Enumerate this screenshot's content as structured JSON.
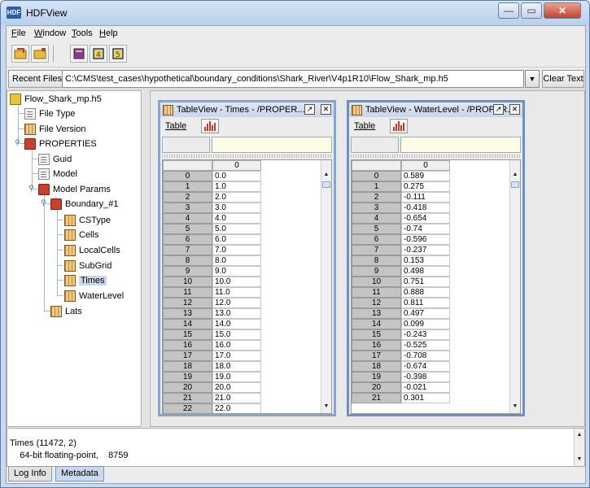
{
  "app": {
    "title": "HDFView",
    "icon_text": "HDF",
    "accent": "#2c5fa8"
  },
  "window_controls": {
    "minimize": "—",
    "maximize": "▭",
    "close": "✕"
  },
  "menu": [
    {
      "label": "File",
      "mnemonic": "F",
      "rest": "ile"
    },
    {
      "label": "Window",
      "mnemonic": "W",
      "rest": "indow"
    },
    {
      "label": "Tools",
      "mnemonic": "T",
      "rest": "ools"
    },
    {
      "label": "Help",
      "mnemonic": "H",
      "rest": "elp"
    }
  ],
  "toolbar": {
    "icons": [
      "open-file-icon",
      "open-folder-icon",
      "book-icon",
      "users-guide-icon",
      "hdf5-guide-icon"
    ]
  },
  "recent": {
    "button_label": "Recent Files",
    "path": "C:\\CMS\\test_cases\\hypothetical\\boundary_conditions\\Shark_River\\V4p1R10\\Flow_Shark_mp.h5",
    "clear_label": "Clear Text"
  },
  "tree": {
    "nodes": [
      {
        "label": "Flow_Shark_mp.h5",
        "icon": "hdf-file-icon"
      },
      {
        "label": "File Type",
        "icon": "attribute-icon"
      },
      {
        "label": "File Version",
        "icon": "dataset-icon"
      },
      {
        "label": "PROPERTIES",
        "icon": "group-folder-icon"
      },
      {
        "label": "Guid",
        "icon": "attribute-icon"
      },
      {
        "label": "Model",
        "icon": "attribute-icon"
      },
      {
        "label": "Model Params",
        "icon": "group-folder-icon"
      },
      {
        "label": "Boundary_#1",
        "icon": "group-folder-icon"
      },
      {
        "label": "CSType",
        "icon": "dataset-icon"
      },
      {
        "label": "Cells",
        "icon": "dataset-icon"
      },
      {
        "label": "LocalCells",
        "icon": "dataset-icon"
      },
      {
        "label": "SubGrid",
        "icon": "dataset-icon"
      },
      {
        "label": "Times",
        "icon": "dataset-icon",
        "selected": true
      },
      {
        "label": "WaterLevel",
        "icon": "dataset-icon"
      },
      {
        "label": "Lats",
        "icon": "dataset-icon"
      }
    ]
  },
  "tables": [
    {
      "title": "TableView  -  Times  -  /PROPER...",
      "menu_label": "Table",
      "column_header": "0",
      "rows": [
        {
          "index": "0",
          "value": "0.0"
        },
        {
          "index": "1",
          "value": "1.0"
        },
        {
          "index": "2",
          "value": "2.0"
        },
        {
          "index": "3",
          "value": "3.0"
        },
        {
          "index": "4",
          "value": "4.0"
        },
        {
          "index": "5",
          "value": "5.0"
        },
        {
          "index": "6",
          "value": "6.0"
        },
        {
          "index": "7",
          "value": "7.0"
        },
        {
          "index": "8",
          "value": "8.0"
        },
        {
          "index": "9",
          "value": "9.0"
        },
        {
          "index": "10",
          "value": "10.0"
        },
        {
          "index": "11",
          "value": "11.0"
        },
        {
          "index": "12",
          "value": "12.0"
        },
        {
          "index": "13",
          "value": "13.0"
        },
        {
          "index": "14",
          "value": "14.0"
        },
        {
          "index": "15",
          "value": "15.0"
        },
        {
          "index": "16",
          "value": "16.0"
        },
        {
          "index": "17",
          "value": "17.0"
        },
        {
          "index": "18",
          "value": "18.0"
        },
        {
          "index": "19",
          "value": "19.0"
        },
        {
          "index": "20",
          "value": "20.0"
        },
        {
          "index": "21",
          "value": "21.0"
        },
        {
          "index": "22",
          "value": "22.0"
        }
      ]
    },
    {
      "title": "TableView  -  WaterLevel  -  /PROPER...",
      "menu_label": "Table",
      "column_header": "0",
      "rows": [
        {
          "index": "0",
          "value": "0.589"
        },
        {
          "index": "1",
          "value": "0.275"
        },
        {
          "index": "2",
          "value": "-0.111"
        },
        {
          "index": "3",
          "value": "-0.418"
        },
        {
          "index": "4",
          "value": "-0.654"
        },
        {
          "index": "5",
          "value": "-0.74"
        },
        {
          "index": "6",
          "value": "-0.596"
        },
        {
          "index": "7",
          "value": "-0.237"
        },
        {
          "index": "8",
          "value": "0.153"
        },
        {
          "index": "9",
          "value": "0.498"
        },
        {
          "index": "10",
          "value": "0.751"
        },
        {
          "index": "11",
          "value": "0.888"
        },
        {
          "index": "12",
          "value": "0.811"
        },
        {
          "index": "13",
          "value": "0.497"
        },
        {
          "index": "14",
          "value": "0.099"
        },
        {
          "index": "15",
          "value": "-0.243"
        },
        {
          "index": "16",
          "value": "-0.525"
        },
        {
          "index": "17",
          "value": "-0.708"
        },
        {
          "index": "18",
          "value": "-0.674"
        },
        {
          "index": "19",
          "value": "-0.398"
        },
        {
          "index": "20",
          "value": "-0.021"
        },
        {
          "index": "21",
          "value": "0.301"
        }
      ]
    }
  ],
  "status": {
    "line1": "Times (11472, 2)",
    "line2": "    64-bit floating-point,    8759"
  },
  "bottom_tabs": [
    {
      "label": "Log Info",
      "active": false
    },
    {
      "label": "Metadata",
      "active": true
    }
  ]
}
